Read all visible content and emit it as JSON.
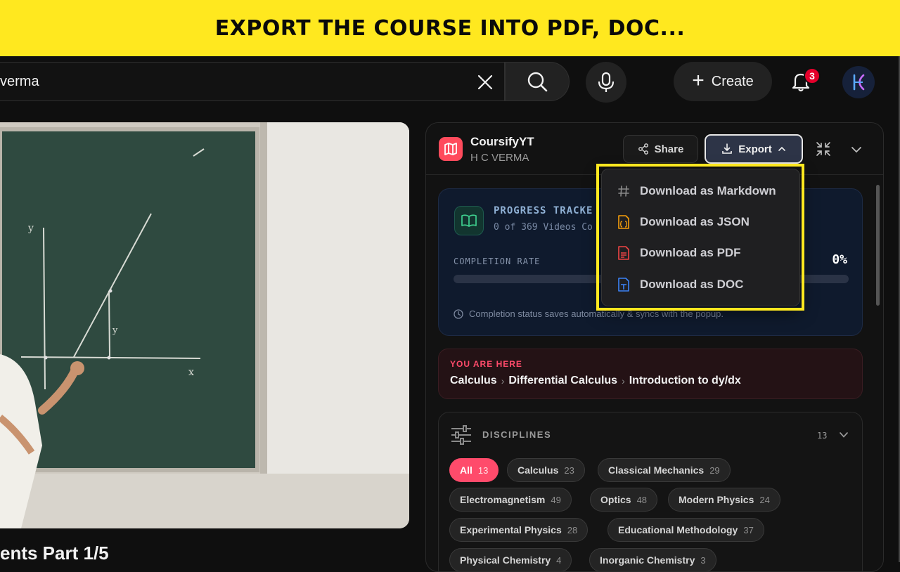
{
  "banner": {
    "text": "EXPORT THE COURSE INTO PDF, DOC..."
  },
  "search": {
    "value": "verma"
  },
  "topbar": {
    "create_label": "Create",
    "notification_count": "3"
  },
  "video": {
    "title": "ents Part 1/5"
  },
  "panel": {
    "app_name": "CoursifyYT",
    "app_subtitle": "H C VERMA",
    "share_label": "Share",
    "export_label": "Export"
  },
  "progress": {
    "title": "PROGRESS TRACKE",
    "subtitle": "0 of 369 Videos Co",
    "completion_label": "COMPLETION RATE",
    "completion_value": "0%",
    "completion_fraction": 0,
    "note": "Completion status saves automatically & syncs with the popup."
  },
  "breadcrumb": {
    "label": "YOU ARE HERE",
    "items": [
      "Calculus",
      "Differential Calculus",
      "Introduction to dy/dx"
    ]
  },
  "disciplines": {
    "title": "DISCIPLINES",
    "count": "13",
    "chips": [
      {
        "label": "All",
        "count": "13"
      },
      {
        "label": "Calculus",
        "count": "23"
      },
      {
        "label": "Classical Mechanics",
        "count": "29"
      },
      {
        "label": "Electromagnetism",
        "count": "49"
      },
      {
        "label": "Optics",
        "count": "48"
      },
      {
        "label": "Modern Physics",
        "count": "24"
      },
      {
        "label": "Experimental Physics",
        "count": "28"
      },
      {
        "label": "Educational Methodology",
        "count": "37"
      },
      {
        "label": "Physical Chemistry",
        "count": "4"
      },
      {
        "label": "Inorganic Chemistry",
        "count": "3"
      }
    ]
  },
  "export_menu": {
    "items": [
      {
        "label": "Download as Markdown",
        "icon": "hash-icon",
        "color": "#8a8a8a"
      },
      {
        "label": "Download as JSON",
        "icon": "json-file-icon",
        "color": "#f59e0b"
      },
      {
        "label": "Download as PDF",
        "icon": "pdf-file-icon",
        "color": "#ef4444"
      },
      {
        "label": "Download as DOC",
        "icon": "doc-file-icon",
        "color": "#3b82f6"
      }
    ]
  },
  "colors": {
    "accent": "#ff4b6b",
    "banner": "#ffe81f",
    "highlight": "#ffe81f"
  }
}
